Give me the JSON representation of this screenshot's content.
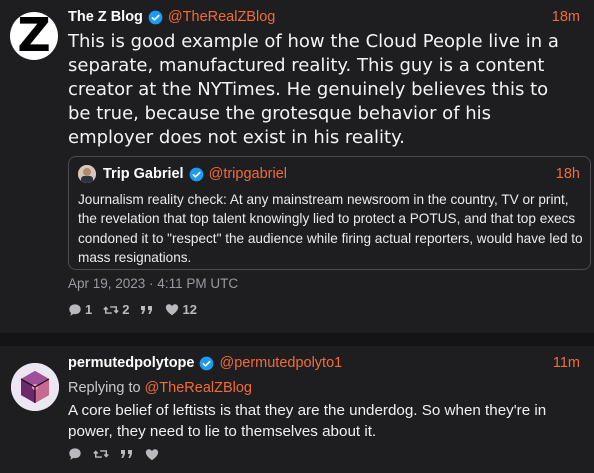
{
  "colors": {
    "background": "#1e1e21",
    "accent": "#f36b39",
    "verified": "#1d9bf0",
    "muted": "#9a9aa0"
  },
  "post": {
    "author": "The Z Blog",
    "handle": "@TheRealZBlog",
    "time": "18m",
    "text": "This is good example of how the Cloud People live in a separate, manufactured reality. This guy is a content creator at the NYTimes. He genuinely believes this to be true, because the grotesque behavior of his employer does not exist in his reality.",
    "timestamp": "Apr 19, 2023 · 4:11 PM UTC",
    "stats": {
      "replies": "1",
      "reposts": "2",
      "quotes": "",
      "likes": "12"
    },
    "quote": {
      "author": "Trip Gabriel",
      "handle": "@tripgabriel",
      "time": "18h",
      "text": "Journalism reality check: At any mainstream newsroom in the country, TV or print, the revelation that top talent knowingly lied to protect a POTUS, and that top execs condoned it to \"respect\" the audience while firing actual reporters, would have led to mass resignations."
    }
  },
  "reply": {
    "author": "permutedpolytope",
    "handle": "@permutedpolyto1",
    "time": "11m",
    "replying_label": "Replying to",
    "replying_handle": "@TheRealZBlog",
    "text": "A core belief of leftists is that they are the underdog. So when they're in power, they need to lie to themselves about it."
  },
  "icons": [
    "verified-badge-icon",
    "reply-icon",
    "repost-icon",
    "quote-icon",
    "heart-icon"
  ]
}
